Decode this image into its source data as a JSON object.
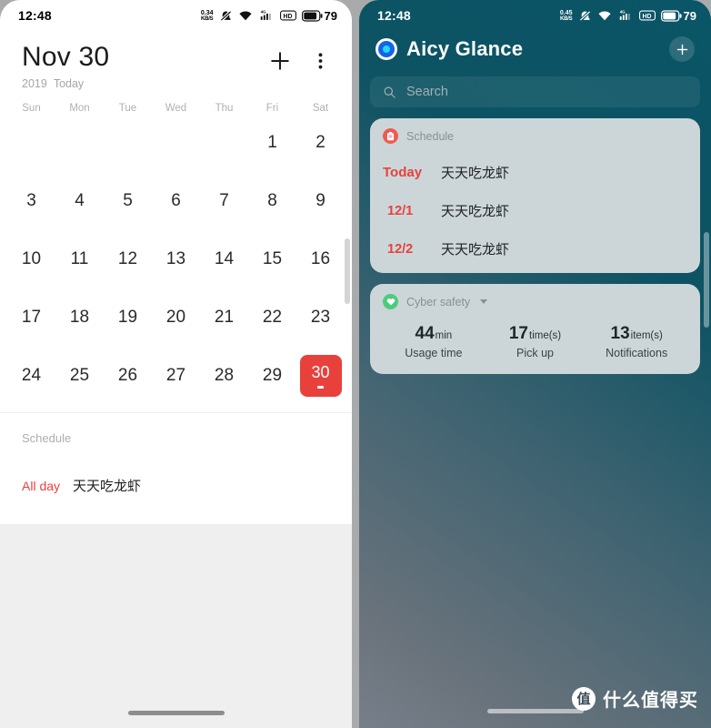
{
  "left_panel": {
    "status_bar": {
      "time": "12:48",
      "net_speed_value": "0.34",
      "net_speed_unit": "KB/S",
      "battery_percent": "79",
      "icons": [
        "mute-icon",
        "wifi-icon",
        "signal-4g-icon",
        "hd-icon",
        "battery-icon"
      ]
    },
    "header": {
      "title": "Nov 30",
      "year": "2019",
      "today_label": "Today",
      "add_label": "+",
      "menu_label": "⋮"
    },
    "weekdays": [
      "Sun",
      "Mon",
      "Tue",
      "Wed",
      "Thu",
      "Fri",
      "Sat"
    ],
    "calendar": {
      "leading_blanks": 5,
      "days": [
        1,
        2,
        3,
        4,
        5,
        6,
        7,
        8,
        9,
        10,
        11,
        12,
        13,
        14,
        15,
        16,
        17,
        18,
        19,
        20,
        21,
        22,
        23,
        24,
        25,
        26,
        27,
        28,
        29,
        30
      ],
      "selected_day": 30,
      "selected_color": "#e8413c",
      "selected_has_event_dot": true
    },
    "schedule": {
      "section_label": "Schedule",
      "entries": [
        {
          "time": "All day",
          "title": "天天吃龙虾"
        }
      ]
    }
  },
  "right_panel": {
    "status_bar": {
      "time": "12:48",
      "net_speed_value": "0.45",
      "net_speed_unit": "KB/S",
      "battery_percent": "79"
    },
    "header": {
      "title": "Aicy Glance",
      "logo_name": "aicy-logo-icon",
      "add_label": "+"
    },
    "search": {
      "placeholder": "Search",
      "value": ""
    },
    "schedule_card": {
      "title": "Schedule",
      "badge_color": "#f05a52",
      "items": [
        {
          "date": "Today",
          "title": "天天吃龙虾"
        },
        {
          "date": "12/1",
          "title": "天天吃龙虾"
        },
        {
          "date": "12/2",
          "title": "天天吃龙虾"
        }
      ]
    },
    "cyber_safety_card": {
      "title": "Cyber safety",
      "badge_color": "#4dcb7d",
      "has_dropdown": true,
      "stats": [
        {
          "value": "44",
          "unit": "min",
          "label": "Usage time"
        },
        {
          "value": "17",
          "unit": "time(s)",
          "label": "Pick up"
        },
        {
          "value": "13",
          "unit": "item(s)",
          "label": "Notifications"
        }
      ]
    },
    "watermark": {
      "badge": "值",
      "text": "什么值得买"
    }
  }
}
